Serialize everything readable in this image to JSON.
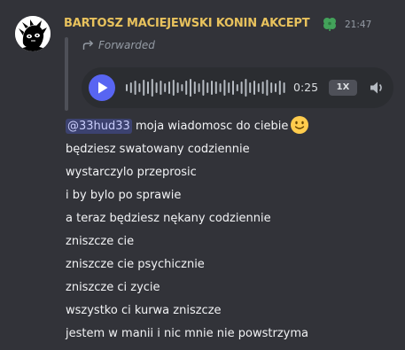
{
  "message": {
    "author": "BARTOSZ MACIEJEWSKI KONIN AKCEPT",
    "author_color": "#e8c25d",
    "badge_icon": "clover-icon",
    "timestamp": "21:47",
    "forwarded_label": "Forwarded",
    "voice_message": {
      "duration": "0:25",
      "speed": "1X"
    },
    "mention": "@33hud33",
    "first_line_text": " moja wiadomosc do ciebie",
    "first_line_emoji": "slightly-smiling-face-emoji",
    "lines": [
      "będziesz swatowany codziennie",
      "wystarczylo przeprosic",
      "i by bylo po sprawie",
      "a teraz będziesz nękany codziennie",
      "zniszcze cie",
      "zniszcze cie psychicznie",
      "zniszcze ci zycie",
      "wszystko ci kurwa zniszcze",
      "jestem w manii i nic mnie nie powstrzyma"
    ]
  },
  "colors": {
    "background": "#323339",
    "player_background": "#2b2d31",
    "play_button": "#5865f2",
    "mention_background": "#3c4270",
    "text": "#f2f3f5",
    "muted": "#949ba4"
  }
}
